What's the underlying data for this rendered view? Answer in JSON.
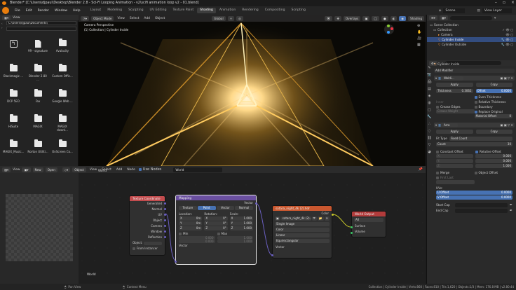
{
  "window": {
    "title": "Blender* [C:\\Users\\djpaul\\Desktop\\Blender 2.8 - Sci-Fi Looping Animation - v2\\scifi animation loop v2 - 01.blend]"
  },
  "menu": {
    "items": [
      "File",
      "Edit",
      "Render",
      "Window",
      "Help"
    ]
  },
  "workspaces": {
    "tabs": [
      "Layout",
      "Modeling",
      "Sculpting",
      "UV Editing",
      "Texture Paint",
      "Shading",
      "Animation",
      "Rendering",
      "Compositing",
      "Scripting"
    ],
    "active": "Shading"
  },
  "scene": {
    "label": "Scene",
    "view_layer": "View Layer"
  },
  "filebrowser": {
    "menus": [
      "View"
    ],
    "path": "C:\\Users\\djpaul\\Documents\\",
    "items": [
      {
        "name": "",
        "kind": "up"
      },
      {
        "name": "99 - signature",
        "kind": "folder"
      },
      {
        "name": "Avalacity",
        "kind": "folder"
      },
      {
        "name": "Blackmagic ...",
        "kind": "folder"
      },
      {
        "name": "Blender 2.80 ...",
        "kind": "folder"
      },
      {
        "name": "Custom Offic...",
        "kind": "folder"
      },
      {
        "name": "DCP 5EO",
        "kind": "folder"
      },
      {
        "name": "Fax",
        "kind": "folder"
      },
      {
        "name": "Google Web ...",
        "kind": "folder"
      },
      {
        "name": "HiSuite",
        "kind": "folder"
      },
      {
        "name": "MAGIX",
        "kind": "folder"
      },
      {
        "name": "MAGIX downl...",
        "kind": "folder"
      },
      {
        "name": "MAGIX_Music...",
        "kind": "folder"
      },
      {
        "name": "Norton Utiliti...",
        "kind": "folder"
      },
      {
        "name": "OnScreen Co...",
        "kind": "folder"
      }
    ]
  },
  "viewport": {
    "mode": "Object Mode",
    "menus": [
      "View",
      "Select",
      "Add",
      "Object"
    ],
    "orientation": "Global",
    "overlays": "Overlays",
    "shading": "Shading",
    "camera_label": "Camera Perspective",
    "object_label": "(1) Collection | Cylinder Inside"
  },
  "outliner": {
    "items": [
      {
        "name": "Scene Collection",
        "indent": 0,
        "selected": false
      },
      {
        "name": "Collection",
        "indent": 1,
        "selected": false
      },
      {
        "name": "Camera",
        "indent": 2,
        "selected": false
      },
      {
        "name": "Cylinder Inside",
        "indent": 2,
        "selected": true
      },
      {
        "name": "Cylinder Outside",
        "indent": 2,
        "selected": false
      }
    ]
  },
  "properties": {
    "object": "Cylinder Inside",
    "add_modifier": "Add Modifier",
    "weld": {
      "name": "Weldi...",
      "apply": "Apply",
      "copy": "Copy",
      "thickness_label": "Thickness",
      "thickness": "0.3062",
      "offset_label": "Offset",
      "offset": "0.0000",
      "even_thickness": "Even Thickness",
      "relative_thickness": "Relative Thickness",
      "boundary": "Boundary",
      "replace_original": "Replace Original",
      "crease_edges": "Crease Edges",
      "material_offset": "Material Offset",
      "material_offset_value": "0",
      "faded1": "Inner",
      "faded2": "Crease Weight"
    },
    "array": {
      "name": "Arra",
      "apply": "Apply",
      "copy": "Copy",
      "fit_type_label": "Fit Type",
      "fit_type": "Fixed Count",
      "count_label": "Count",
      "count": "30",
      "constant_offset": "Constant Offset",
      "relative_offset": "Relative Offset",
      "rel_values": [
        "0.000",
        "0.000",
        "1.000"
      ],
      "merge": "Merge",
      "object_offset": "Object Offset",
      "first_last": "First Last",
      "uvs": "UVs:",
      "u_offset": "U Offset",
      "u_offset_value": "0.0000",
      "v_offset": "V Offset",
      "v_offset_value": "0.0000",
      "start_cap": "Start Cap",
      "end_cap": "End Cap"
    }
  },
  "node_editor": {
    "menus": [
      "View",
      "Select",
      "Add",
      "Node"
    ],
    "object_type": "Object",
    "world": "World",
    "use_nodes": "Use Nodes",
    "world_name": "World",
    "left_menus": [
      "View"
    ],
    "left_new": "New",
    "left_open": "Open",
    "context_label": "World",
    "texcoord": {
      "title": "Texture Coordinate",
      "outputs": [
        "Generated",
        "Normal",
        "UV",
        "Object",
        "Camera",
        "Window",
        "Reflection"
      ],
      "object_label": "Object:",
      "from_instancer": "From Instancer"
    },
    "mapping": {
      "title": "Mapping",
      "output": "Vector",
      "types": [
        "Texture",
        "Point",
        "Vector",
        "Normal"
      ],
      "active_type": "Point",
      "location_label": "Location:",
      "rotation_label": "Rotation:",
      "scale_label": "Scale:",
      "loc": [
        [
          "X",
          "0m"
        ],
        [
          "Y",
          "0m"
        ],
        [
          "Z",
          "0m"
        ]
      ],
      "rot": [
        [
          "X",
          "0°"
        ],
        [
          "Y",
          "0°"
        ],
        [
          "Z",
          "0°"
        ]
      ],
      "scale": [
        [
          "X",
          "1.000"
        ],
        [
          "Y",
          "1.000"
        ],
        [
          "Z",
          "1.000"
        ]
      ],
      "min": "Min",
      "max": "Max",
      "min_vals": [
        "0.000",
        "0.000",
        "0.000"
      ],
      "max_vals": [
        "1.000",
        "1.000",
        "1.000"
      ],
      "input": "Vector"
    },
    "envtex": {
      "title": "satara_night_4k (2).hdr",
      "output": "Color",
      "image": "satara_night_4k (2)...",
      "source": "Single Image",
      "colorspace": "Color",
      "interp": "Linear",
      "proj": "Equirectangular",
      "input": "Vector"
    },
    "world_output": {
      "title": "World Output",
      "target": "All",
      "inputs": [
        "Surface",
        "Volume"
      ]
    }
  },
  "status": {
    "left": "Pan View",
    "middle": "Context Menu",
    "right": "Collection | Cylinder Inside | Verts:860 | Faces:810 | Tris:1,620 | Objects:1/3 | Mem: 176.8 MB | v2.80.44"
  },
  "colors": {
    "accent": "#4772b3",
    "active_object": "#ee9e3c",
    "node_texture": "#c24c4e",
    "node_vector": "#6a4fa0",
    "node_env": "#c9572f",
    "node_output": "#b23b3b"
  }
}
